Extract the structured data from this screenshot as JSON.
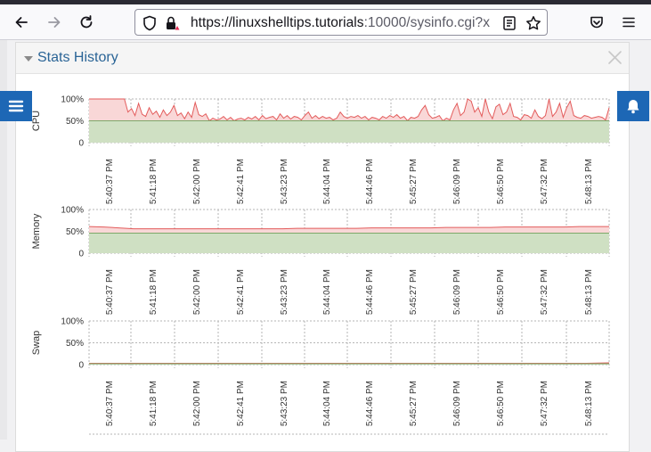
{
  "browser": {
    "url_host": "https://linuxshelltips.tutorials",
    "url_rest": ":10000/sysinfo.cgi?x",
    "icons": {
      "back": "arrow-left-icon",
      "forward": "arrow-right-icon",
      "reload": "reload-icon",
      "shield": "shield-icon",
      "lock": "lock-warning-icon",
      "reader": "reader-view-icon",
      "bookmark": "star-icon",
      "pocket": "pocket-icon",
      "menu": "hamburger-menu-icon"
    }
  },
  "panel": {
    "title": "Stats History",
    "close_icon": "close-icon",
    "collapse_icon": "caret-down-icon"
  },
  "left_button_icon": "menu-icon",
  "right_button_icon": "bell-icon",
  "colors": {
    "accent": "#1d67b5",
    "title_blue": "#2a6496",
    "line_red": "#e35b5b",
    "fill_red": "#f9d7d7",
    "fill_green": "#cfe0c3",
    "line_green": "#7ea86a"
  },
  "chart_data": [
    {
      "type": "area",
      "ylabel": "CPU",
      "y_ticks": [
        "100%",
        "50%",
        "0"
      ],
      "ylim": [
        0,
        100
      ],
      "x_labels": [
        "5:40:37 PM",
        "5:41:18 PM",
        "5:42:00 PM",
        "5:42:41 PM",
        "5:43:23 PM",
        "5:44:04 PM",
        "5:44:46 PM",
        "5:45:27 PM",
        "5:46:09 PM",
        "5:46:50 PM",
        "5:47:32 PM",
        "5:48:13 PM"
      ],
      "grid": true,
      "series": [
        {
          "values": [
            100,
            100,
            100,
            100,
            100,
            100,
            100,
            100,
            100,
            100,
            100,
            70,
            78,
            62,
            90,
            65,
            60,
            80,
            65,
            72,
            58,
            75,
            62,
            70,
            85,
            62,
            68,
            55,
            70,
            58,
            92,
            64,
            60,
            66,
            50,
            56,
            52,
            54,
            60,
            52,
            58,
            50,
            54,
            56,
            52,
            58,
            54,
            60,
            52,
            62,
            55,
            58,
            60,
            52,
            66,
            56,
            62,
            54,
            60,
            58,
            52,
            62,
            70,
            56,
            62,
            55,
            60,
            56,
            58,
            52,
            56,
            70,
            60,
            56,
            60,
            58,
            62,
            56,
            60,
            52,
            58,
            56,
            52,
            60,
            56,
            62,
            58,
            64,
            56,
            60,
            50,
            58,
            56,
            60,
            75,
            85,
            64,
            56,
            58,
            62,
            50,
            56,
            52,
            75,
            90,
            62,
            70,
            100,
            95,
            70,
            80,
            60,
            100,
            70,
            55,
            82,
            88,
            64,
            70,
            90,
            60,
            58,
            52,
            64,
            62,
            56,
            75,
            60,
            55,
            62,
            100,
            60,
            70,
            90,
            58,
            80,
            95,
            62,
            58,
            56,
            62,
            60,
            56,
            58,
            60,
            58,
            52,
            80
          ]
        },
        {
          "values": [
            50
          ]
        }
      ]
    },
    {
      "type": "area",
      "ylabel": "Memory",
      "y_ticks": [
        "100%",
        "50%",
        "0"
      ],
      "ylim": [
        0,
        100
      ],
      "x_labels": [
        "5:40:37 PM",
        "5:41:18 PM",
        "5:42:00 PM",
        "5:42:41 PM",
        "5:43:23 PM",
        "5:44:04 PM",
        "5:44:46 PM",
        "5:45:27 PM",
        "5:46:09 PM",
        "5:46:50 PM",
        "5:47:32 PM",
        "5:48:13 PM"
      ],
      "grid": true,
      "series": [
        {
          "values": [
            61,
            60,
            58,
            56,
            56,
            56,
            56,
            56,
            56,
            56,
            56,
            56,
            56,
            56,
            57,
            57,
            57,
            57,
            57,
            58,
            58,
            58,
            58,
            58,
            59,
            59,
            59,
            59,
            60,
            60,
            60,
            60,
            60,
            61,
            61,
            61
          ]
        },
        {
          "values": [
            46
          ]
        }
      ]
    },
    {
      "type": "area",
      "ylabel": "Swap",
      "y_ticks": [
        "100%",
        "50%",
        "0"
      ],
      "ylim": [
        0,
        100
      ],
      "x_labels": [
        "5:40:37 PM",
        "5:41:18 PM",
        "5:42:00 PM",
        "5:42:41 PM",
        "5:43:23 PM",
        "5:44:04 PM",
        "5:44:46 PM",
        "5:45:27 PM",
        "5:46:09 PM",
        "5:46:50 PM",
        "5:47:32 PM",
        "5:48:13 PM"
      ],
      "grid": true,
      "series": [
        {
          "values": [
            3,
            3,
            3,
            3,
            3,
            3,
            3,
            3,
            3,
            3,
            3,
            3,
            3,
            3,
            3,
            3,
            3,
            3,
            3,
            3,
            3,
            3,
            3,
            4
          ]
        },
        {
          "values": [
            2
          ]
        }
      ]
    }
  ]
}
